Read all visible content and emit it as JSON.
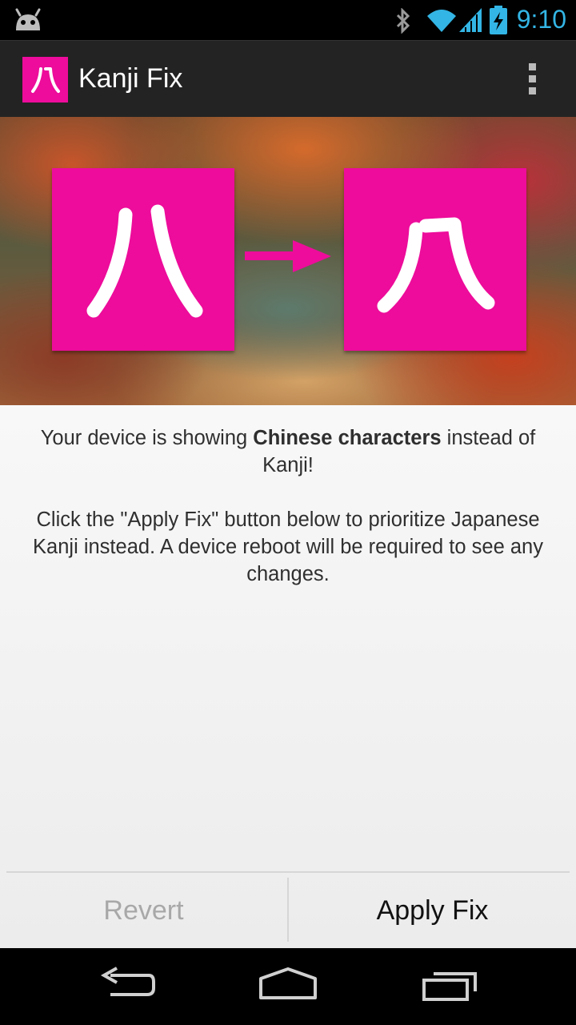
{
  "status_bar": {
    "time": "9:10",
    "accent_color": "#33b5e5"
  },
  "action_bar": {
    "title": "Kanji Fix",
    "brand_color": "#ed0c9b"
  },
  "hero": {
    "before_icon": "chinese-eight-character",
    "after_icon": "japanese-eight-character"
  },
  "message": {
    "line1_prefix": "Your device is showing ",
    "line1_bold": "Chinese characters",
    "line1_suffix": " instead of Kanji!",
    "paragraph2": "Click the \"Apply Fix\" button below to prioritize Japanese Kanji instead. A device reboot will be required to see any changes."
  },
  "buttons": {
    "revert_label": "Revert",
    "apply_label": "Apply Fix"
  },
  "nav": {
    "icons": [
      "back-icon",
      "home-icon",
      "recents-icon"
    ]
  }
}
